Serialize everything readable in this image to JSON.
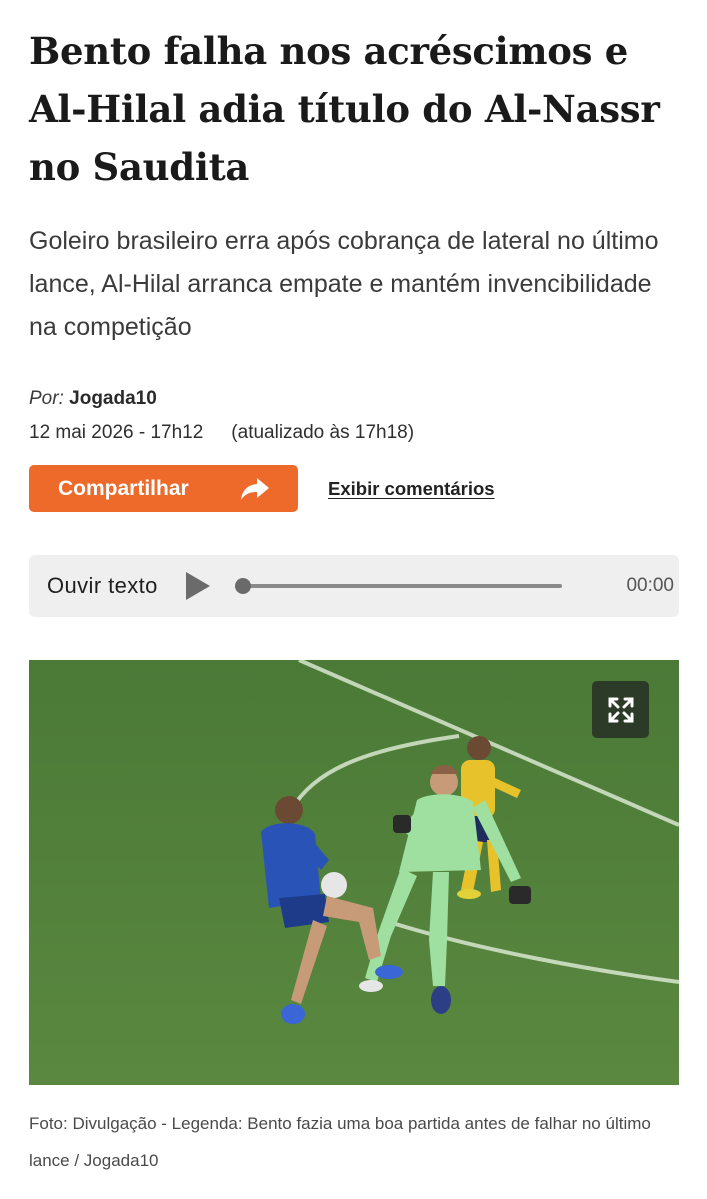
{
  "article": {
    "headline": "Bento falha nos acréscimos e Al-Hilal adia título do Al-Nassr no Saudita",
    "subtitle": "Goleiro brasileiro erra após cobrança de lateral no último lance, Al-Hilal arranca empate e mantém invencibilidade na competição",
    "byline_prefix": "Por:",
    "author": "Jogada10",
    "published": "12 mai 2026 - 17h12",
    "updated": "(atualizado às 17h18)"
  },
  "actions": {
    "share_label": "Compartilhar",
    "share_icon": "share-arrow-icon",
    "comments_label": "Exibir comentários"
  },
  "audio_player": {
    "label": "Ouvir texto",
    "time": "00:00",
    "progress": 0
  },
  "photo": {
    "expand_icon": "expand-icon",
    "caption": "Foto: Divulgação - Legenda: Bento fazia uma boa partida antes de falhar no último lance / Jogada10"
  },
  "colors": {
    "accent": "#ed6a2b",
    "pitch": "#4e7a3c",
    "audio_bg": "#efefef"
  }
}
